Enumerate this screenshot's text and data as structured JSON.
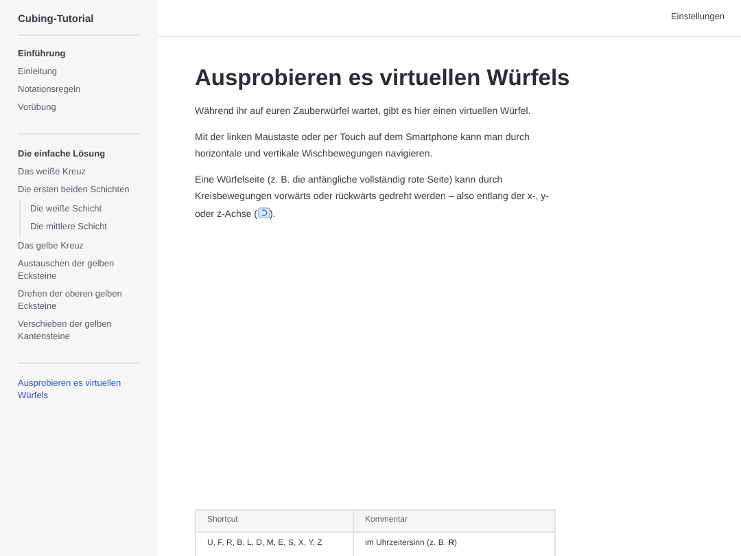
{
  "site_title": "Cubing-Tutorial",
  "topbar": {
    "link": "Einstellungen"
  },
  "sidebar": {
    "sections": [
      {
        "title": "Einführung",
        "items": [
          {
            "label": "Einleitung",
            "selected": false
          },
          {
            "label": "Notationsregeln",
            "selected": false
          },
          {
            "label": "Vorübung",
            "selected": false
          }
        ]
      },
      {
        "title": "Die einfache Lösung",
        "items": [
          {
            "label": "Das weiße Kreuz",
            "selected": false
          },
          {
            "label": "Die ersten beiden Schichten",
            "selected": false,
            "children": [
              {
                "label": "Die weiße Schicht",
                "selected": false
              },
              {
                "label": "Die mittlere Schicht",
                "selected": false
              }
            ]
          },
          {
            "label": "Das gelbe Kreuz",
            "selected": false
          },
          {
            "label": "Austauschen der gelben Ecksteine",
            "selected": false
          },
          {
            "label": "Drehen der oberen gelben Ecksteine",
            "selected": false
          },
          {
            "label": "Verschieben der gelben Kantensteine",
            "selected": false
          }
        ]
      },
      {
        "items": [
          {
            "label": "Ausprobieren es virtuellen Würfels",
            "selected": true
          }
        ]
      }
    ]
  },
  "content": {
    "heading": "Ausprobieren es virtuellen Würfels",
    "paragraphs": [
      {
        "text": "Während ihr auf euren Zauberwürfel wartet, gibt es hier einen virtuellen Würfel."
      },
      {
        "text": "Mit der linken Maustaste oder per Touch auf dem Smartphone kann man durch horizontale und vertikale Wischbewegungen navigieren."
      },
      {
        "text": "Eine Würfelseite (z. B. die anfängliche vollständig rote Seite) kann durch Kreisbewegungen vorwärts oder rückwärts gedreht werden – also entlang der x-, y- oder z-Achse (",
        "icon": true,
        "text_after": ")."
      }
    ],
    "table": {
      "columns": [
        "Shortcut",
        "Kommentar"
      ],
      "rows": [
        [
          "U, F, R, B, L, D, M, E, S, X, Y, Z",
          "im Uhrzeitersinn (z. B. **R**)"
        ]
      ]
    }
  }
}
